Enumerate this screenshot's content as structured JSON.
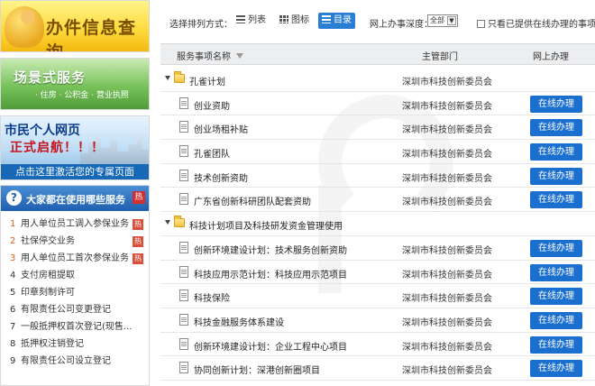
{
  "sidebar": {
    "banner_query": {
      "title": "办件信息查询"
    },
    "banner_scene": {
      "title": "场景式服务",
      "sub": "· 住房 · 公积金 · 营业执照"
    },
    "banner_citizen": {
      "line1": "市民个人网页",
      "line2": "正式启航！！！",
      "bar": "点击这里激活您的专属页面"
    },
    "popular": {
      "title": "大家都在使用哪些服务",
      "hot_badge": "热",
      "items": [
        {
          "num": "1",
          "label": "用人单位员工调入参保业务",
          "hot": "热"
        },
        {
          "num": "2",
          "label": "社保停交业务",
          "hot": "热"
        },
        {
          "num": "3",
          "label": "用人单位员工首次参保业务",
          "hot": "热"
        },
        {
          "num": "4",
          "label": "支付房租提取",
          "hot": ""
        },
        {
          "num": "5",
          "label": "印章刻制许可",
          "hot": ""
        },
        {
          "num": "6",
          "label": "有限责任公司变更登记",
          "hot": ""
        },
        {
          "num": "7",
          "label": "一般抵押权首次登记(现售...",
          "hot": ""
        },
        {
          "num": "8",
          "label": "抵押权注销登记",
          "hot": ""
        },
        {
          "num": "9",
          "label": "有限责任公司设立登记",
          "hot": ""
        }
      ]
    }
  },
  "toolbar": {
    "sort_label": "选择排列方式：",
    "list_label": "列表",
    "icon_label": "图标",
    "dir_label": "目录",
    "depth_label": "网上办事深度：",
    "depth_value": "全部",
    "only_online_label": "只看已提供在线办理的事项"
  },
  "table": {
    "col_service": "服务事项名称",
    "col_dept": "主管部门",
    "col_online": "网上办理",
    "rows": [
      {
        "type": "group",
        "name": "孔雀计划",
        "dept": "深圳市科技创新委员会",
        "btn": ""
      },
      {
        "type": "item",
        "name": "创业资助",
        "dept": "深圳市科技创新委员会",
        "btn": "在线办理"
      },
      {
        "type": "item",
        "name": "创业场租补贴",
        "dept": "深圳市科技创新委员会",
        "btn": "在线办理"
      },
      {
        "type": "item",
        "name": "孔雀团队",
        "dept": "深圳市科技创新委员会",
        "btn": "在线办理"
      },
      {
        "type": "item",
        "name": "技术创新资助",
        "dept": "深圳市科技创新委员会",
        "btn": "在线办理"
      },
      {
        "type": "item",
        "name": "广东省创新科研团队配套资助",
        "dept": "深圳市科技创新委员会",
        "btn": "在线办理"
      },
      {
        "type": "group",
        "name": "科技计划项目及科技研发资金管理使用",
        "dept": "",
        "btn": ""
      },
      {
        "type": "item",
        "name": "创新环境建设计划：技术服务创新资助",
        "dept": "深圳市科技创新委员会",
        "btn": "在线办理"
      },
      {
        "type": "item",
        "name": "科技应用示范计划：科技应用示范项目",
        "dept": "深圳市科技创新委员会",
        "btn": "在线办理"
      },
      {
        "type": "item",
        "name": "科技保险",
        "dept": "深圳市科技创新委员会",
        "btn": "在线办理"
      },
      {
        "type": "item",
        "name": "科技金融服务体系建设",
        "dept": "深圳市科技创新委员会",
        "btn": "在线办理"
      },
      {
        "type": "item",
        "name": "创新环境建设计划：企业工程中心项目",
        "dept": "深圳市科技创新委员会",
        "btn": "在线办理"
      },
      {
        "type": "item",
        "name": "协同创新计划：深港创新圈项目",
        "dept": "深圳市科技创新委员会",
        "btn": "在线办理"
      }
    ]
  }
}
